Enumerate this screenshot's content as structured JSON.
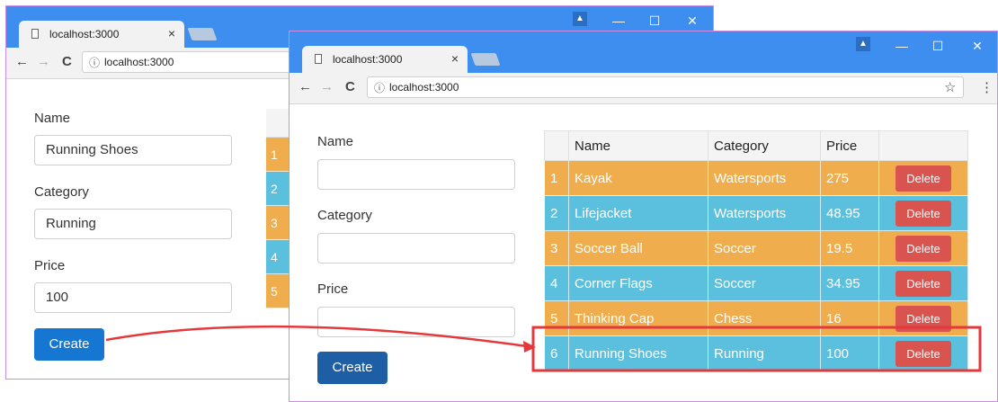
{
  "browser": {
    "tab_title": "localhost:3000",
    "url": "localhost:3000",
    "info_icon": "ⓘ",
    "close_glyph": "×",
    "min_glyph": "—",
    "max_glyph": "☐",
    "win_close_glyph": "✕",
    "back_glyph": "←",
    "forward_glyph": "→",
    "reload_glyph": "C",
    "star_glyph": "☆",
    "menu_glyph": "⋮"
  },
  "form": {
    "name_label": "Name",
    "category_label": "Category",
    "price_label": "Price",
    "create_label": "Create"
  },
  "left_form_values": {
    "name": "Running Shoes",
    "category": "Running",
    "price": "100"
  },
  "left_table_ids": [
    "1",
    "2",
    "3",
    "4",
    "5"
  ],
  "table": {
    "headers": [
      "",
      "Name",
      "Category",
      "Price",
      ""
    ],
    "rows": [
      {
        "id": "1",
        "name": "Kayak",
        "category": "Watersports",
        "price": "275",
        "action": "Delete"
      },
      {
        "id": "2",
        "name": "Lifejacket",
        "category": "Watersports",
        "price": "48.95",
        "action": "Delete"
      },
      {
        "id": "3",
        "name": "Soccer Ball",
        "category": "Soccer",
        "price": "19.5",
        "action": "Delete"
      },
      {
        "id": "4",
        "name": "Corner Flags",
        "category": "Soccer",
        "price": "34.95",
        "action": "Delete"
      },
      {
        "id": "5",
        "name": "Thinking Cap",
        "category": "Chess",
        "price": "16",
        "action": "Delete"
      },
      {
        "id": "6",
        "name": "Running Shoes",
        "category": "Running",
        "price": "100",
        "action": "Delete"
      }
    ]
  },
  "colors": {
    "titlebar": "#3d8eef",
    "row_orange": "#f0ad4e",
    "row_blue": "#5bc0de",
    "delete_button": "#d9534f",
    "create_button": "#1677d2",
    "highlight_arrow": "#e4393c"
  }
}
